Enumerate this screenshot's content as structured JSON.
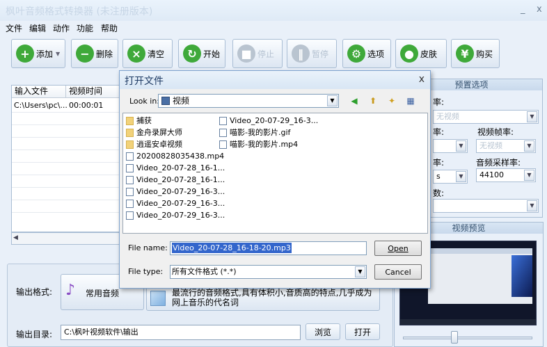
{
  "window": {
    "title": "枫叶音频格式转换器 (未注册版本)",
    "minimize": "_",
    "close": "x"
  },
  "menu": [
    "文件",
    "编辑",
    "动作",
    "功能",
    "帮助"
  ],
  "toolbar": {
    "add": "添加",
    "delete": "删除",
    "clear": "清空",
    "start": "开始",
    "stop": "停止",
    "pause": "暂停",
    "options": "选项",
    "skin": "皮肤",
    "buy": "购买"
  },
  "file_table": {
    "columns": [
      "输入文件",
      "视频时间"
    ],
    "rows": [
      {
        "file": "C:\\Users\\pc\\...",
        "time": "00:00:01"
      }
    ]
  },
  "presets": {
    "header": "预置选项",
    "rate_label": "率:",
    "video_placeholder": "无视频",
    "rate_label_2": "率:",
    "video_fps_label": "视频帧率:",
    "video_fps_value": "无视频",
    "rate_label_3": "率:",
    "audio_rate_label": "音频采样率:",
    "audio_rate_value": "44100",
    "small_value": "s",
    "count_label": "数:"
  },
  "preview": {
    "header": "视频预览"
  },
  "output": {
    "format_label": "输出格式:",
    "format_value": "常用音频",
    "description": "最流行的音频格式,具有体积小,音质高的特点,几乎成为网上音乐的代名词",
    "dir_label": "输出目录:",
    "dir_value": "C:\\枫叶视频软件\\输出",
    "browse": "浏览",
    "open": "打开"
  },
  "dialog": {
    "title": "打开文件",
    "close": "x",
    "look_in_label": "Look in:",
    "look_in_value": "视频",
    "files_col1": [
      {
        "name": "捕获",
        "kind": "folder"
      },
      {
        "name": "金舟录屏大师",
        "kind": "folder"
      },
      {
        "name": "逍遥安卓视频",
        "kind": "folder"
      },
      {
        "name": "20200828035438.mp4",
        "kind": "file"
      },
      {
        "name": "Video_20-07-28_16-1...",
        "kind": "file"
      },
      {
        "name": "Video_20-07-28_16-1...",
        "kind": "file"
      },
      {
        "name": "Video_20-07-29_16-3...",
        "kind": "file"
      },
      {
        "name": "Video_20-07-29_16-3...",
        "kind": "file"
      },
      {
        "name": "Video_20-07-29_16-3...",
        "kind": "file"
      }
    ],
    "files_col2": [
      {
        "name": "Video_20-07-29_16-3...",
        "kind": "file"
      },
      {
        "name": "喵影-我的影片.gif",
        "kind": "file"
      },
      {
        "name": "喵影-我的影片.mp4",
        "kind": "file"
      }
    ],
    "file_name_label": "File name:",
    "file_name_value": "Video_20-07-28_16-18-20.mp3",
    "file_type_label": "File type:",
    "file_type_value": "所有文件格式 (*.*)",
    "open_button": "Open",
    "cancel_button": "Cancel"
  }
}
